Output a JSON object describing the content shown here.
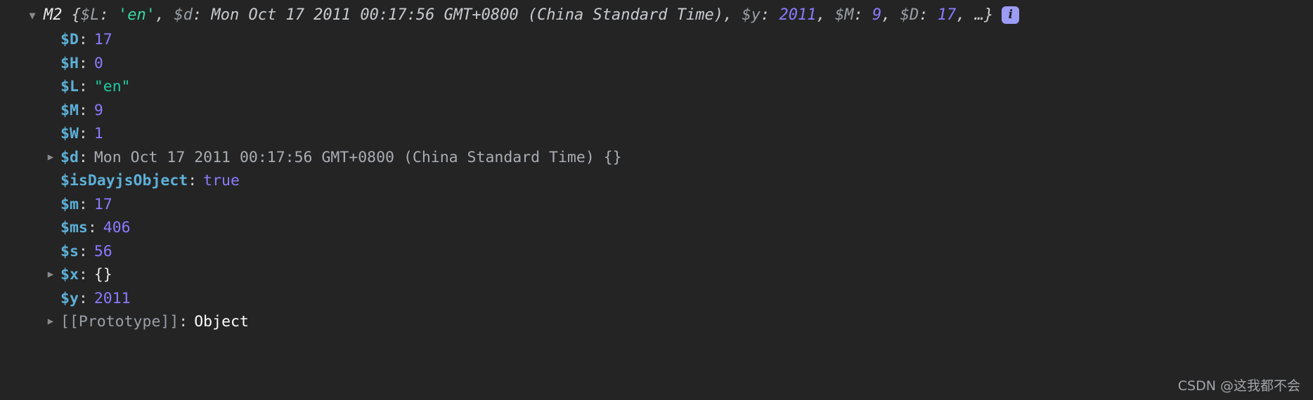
{
  "console": {
    "background_color": "#242424",
    "header": {
      "expander_icon": "triangle-down-icon",
      "expander_state": "expanded",
      "constructor_name": "M2",
      "open_brace": "{",
      "close_brace": "}",
      "ellipsis": "…",
      "info_icon": "info-icon",
      "info_icon_label": "i",
      "preview_parts": [
        {
          "key": "$L",
          "sep": ": ",
          "value": "'en'",
          "kind": "string"
        },
        {
          "key": "$d",
          "sep": ": ",
          "value": "Mon Oct 17 2011 00:17:56 GMT+0800 (China Standard Time)",
          "kind": "plain"
        },
        {
          "key": "$y",
          "sep": ": ",
          "value": "2011",
          "kind": "number"
        },
        {
          "key": "$M",
          "sep": ": ",
          "value": "9",
          "kind": "number"
        },
        {
          "key": "$D",
          "sep": ": ",
          "value": "17",
          "kind": "number"
        }
      ]
    },
    "properties": [
      {
        "name": "$D",
        "value": "17",
        "kind": "number",
        "expandable": false
      },
      {
        "name": "$H",
        "value": "0",
        "kind": "number",
        "expandable": false
      },
      {
        "name": "$L",
        "value": "\"en\"",
        "kind": "string",
        "expandable": false
      },
      {
        "name": "$M",
        "value": "9",
        "kind": "number",
        "expandable": false
      },
      {
        "name": "$W",
        "value": "1",
        "kind": "number",
        "expandable": false
      },
      {
        "name": "$d",
        "value": "Mon Oct 17 2011 00:17:56 GMT+0800 (China Standard Time) {}",
        "kind": "plain",
        "expandable": true
      },
      {
        "name": "$isDayjsObject",
        "value": "true",
        "kind": "boolean",
        "expandable": false
      },
      {
        "name": "$m",
        "value": "17",
        "kind": "number",
        "expandable": false
      },
      {
        "name": "$ms",
        "value": "406",
        "kind": "number",
        "expandable": false
      },
      {
        "name": "$s",
        "value": "56",
        "kind": "number",
        "expandable": false
      },
      {
        "name": "$x",
        "value": "{}",
        "kind": "object",
        "expandable": true
      },
      {
        "name": "$y",
        "value": "2011",
        "kind": "number",
        "expandable": false
      },
      {
        "name": "[[Prototype]]",
        "value": "Object",
        "kind": "white",
        "expandable": true,
        "prototype": true
      }
    ],
    "watermark": "CSDN @这我都不会"
  }
}
